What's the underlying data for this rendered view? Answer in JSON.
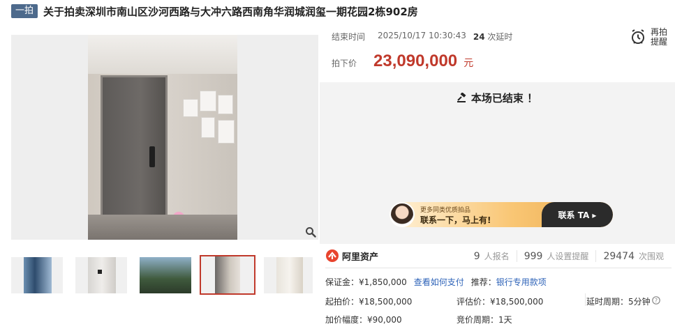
{
  "title": {
    "tag": "一拍",
    "text": "关于拍卖深圳市南山区沙河西路与大冲六路西南角华润城润玺一期花园2栋902房"
  },
  "gallery": {
    "thumbnail_count": 5,
    "active_index": 3
  },
  "auction": {
    "end_label": "结束时间",
    "end_time": "2025/10/17 10:30:43",
    "delay_count": "24",
    "delay_label": "次延时",
    "remind_label_1": "再拍",
    "remind_label_2": "提醒",
    "price_label": "拍下价",
    "price_value": "23,090,000",
    "price_unit": "元",
    "status": "本场已结束 ！"
  },
  "banner": {
    "sub": "更多同类优质拍品",
    "main": "联系一下，马上有!",
    "cta": "联系 TA ▸"
  },
  "platform": {
    "name": "阿里资产"
  },
  "stats": [
    {
      "num": "9",
      "label": "人报名"
    },
    {
      "num": "999",
      "label": "人设置提醒"
    },
    {
      "num": "29474",
      "label": "次围观"
    }
  ],
  "details": {
    "deposit_label": "保证金：",
    "deposit_value": "¥1,850,000",
    "pay_link": "查看如何支付",
    "recommend_label": "推荐：",
    "recommend_link": "银行专用款项",
    "start_price": "起拍价：¥18,500,000",
    "eval_price": "评估价：¥18,500,000",
    "delay_period": "延时周期：5分钟",
    "increment": "加价幅度：¥90,000",
    "bid_period": "竞价周期：1天"
  },
  "colors": {
    "accent": "#c0392b",
    "link": "#2e63b8",
    "tag_bg": "#4d6a8c"
  }
}
